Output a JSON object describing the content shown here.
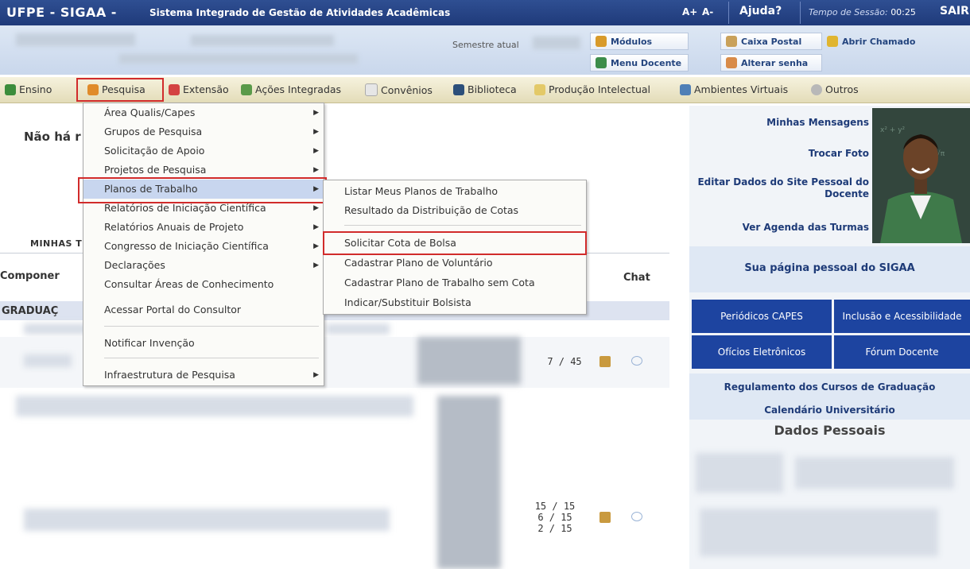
{
  "topbar": {
    "brand": "UFPE - SIGAA -",
    "subtitle": "Sistema Integrado de Gestão de Atividades Acadêmicas",
    "font_increase": "A+",
    "font_decrease": "A-",
    "help": "Ajuda?",
    "session_label": "Tempo de Sessão:",
    "session_time": "00:25",
    "logout": "SAIR"
  },
  "infobar": {
    "semestre_label": "Semestre atual",
    "buttons": {
      "modulos": "Módulos",
      "caixa_postal": "Caixa Postal",
      "abrir_chamado": "Abrir Chamado",
      "menu_docente": "Menu Docente",
      "alterar_senha": "Alterar senha"
    }
  },
  "menubar": {
    "items": [
      "Ensino",
      "Pesquisa",
      "Extensão",
      "Ações Integradas",
      "Convênios",
      "Biblioteca",
      "Produção Intelectual",
      "Ambientes Virtuais",
      "Outros"
    ]
  },
  "pesquisa_menu": {
    "items": [
      "Área Qualis/Capes",
      "Grupos de Pesquisa",
      "Solicitação de Apoio",
      "Projetos de Pesquisa",
      "Planos de Trabalho",
      "Relatórios de Iniciação Científica",
      "Relatórios Anuais de Projeto",
      "Congresso de Iniciação Científica",
      "Declarações",
      "Consultar Áreas de Conhecimento",
      "Acessar Portal do Consultor",
      "Notificar Invenção",
      "Infraestrutura de Pesquisa"
    ]
  },
  "planos_submenu": {
    "items": [
      "Listar Meus Planos de Trabalho",
      "Resultado da Distribuição de Cotas",
      "Solicitar Cota de Bolsa",
      "Cadastrar Plano de Voluntário",
      "Cadastrar Plano de Trabalho sem Cota",
      "Indicar/Substituir Bolsista"
    ]
  },
  "main": {
    "no_msg": "Não há r",
    "minhas_tab": "MINHAS T",
    "col_componente": "Componer",
    "col_chat": "Chat",
    "section_graduacao": "GRADUAÇ",
    "row1_count": "7 / 45",
    "row2_counts": [
      "15 / 15",
      "6 / 15",
      "2 / 15"
    ]
  },
  "right": {
    "minhas_mensagens": "Minhas Mensagens",
    "trocar_foto": "Trocar Foto",
    "editar_dados_line1": "Editar Dados do Site Pessoal do",
    "editar_dados_line2": "Docente",
    "ver_agenda": "Ver Agenda das Turmas",
    "pagina_pessoal": "Sua página pessoal do SIGAA",
    "tiles": [
      "Periódicos CAPES",
      "Inclusão e Acessibilidade",
      "Ofícios Eletrônicos",
      "Fórum Docente"
    ],
    "regulamento": "Regulamento dos Cursos de Graduação",
    "calendario": "Calendário Universitário",
    "dados_pessoais": "Dados Pessoais"
  },
  "colors": {
    "topbar": "#1f3a7a",
    "menubar": "#ece6c8",
    "highlight_box": "#d12b2b",
    "tile_blue": "#1d44a0",
    "link_blue": "#1e3b78"
  }
}
